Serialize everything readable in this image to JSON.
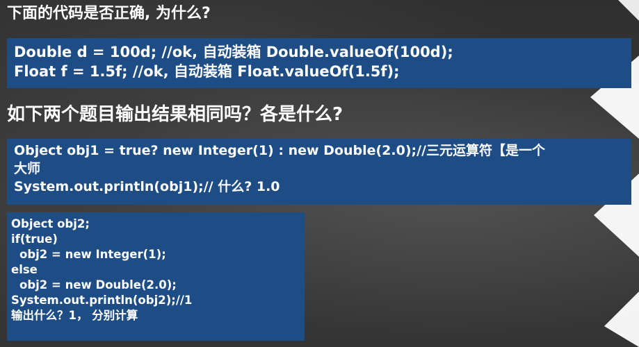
{
  "slide": {
    "question1": {
      "heading": "下面的代码是否正确, 为什么?",
      "lines": [
        "Double d = 100d; //ok, 自动装箱 Double.valueOf(100d);",
        "Float f = 1.5f; //ok, 自动装箱 Float.valueOf(1.5f);"
      ]
    },
    "question2": {
      "heading": "如下两个题目输出结果相同吗？各是什么?",
      "box_a_lines": [
        "Object obj1 = true? new Integer(1) : new Double(2.0);//三元运算符【是一个",
        "大师",
        "System.out.println(obj1);// 什么? 1.0"
      ],
      "box_b_lines": [
        "Object obj2;",
        "if(true)",
        "obj2 = new Integer(1);",
        "else",
        "obj2 = new Double(2.0);",
        "System.out.println(obj2);//1",
        "输出什么？1， 分别计算"
      ]
    }
  },
  "colors": {
    "box_blue": "#1e4d86",
    "background": "#333333",
    "text": "#ffffff"
  }
}
